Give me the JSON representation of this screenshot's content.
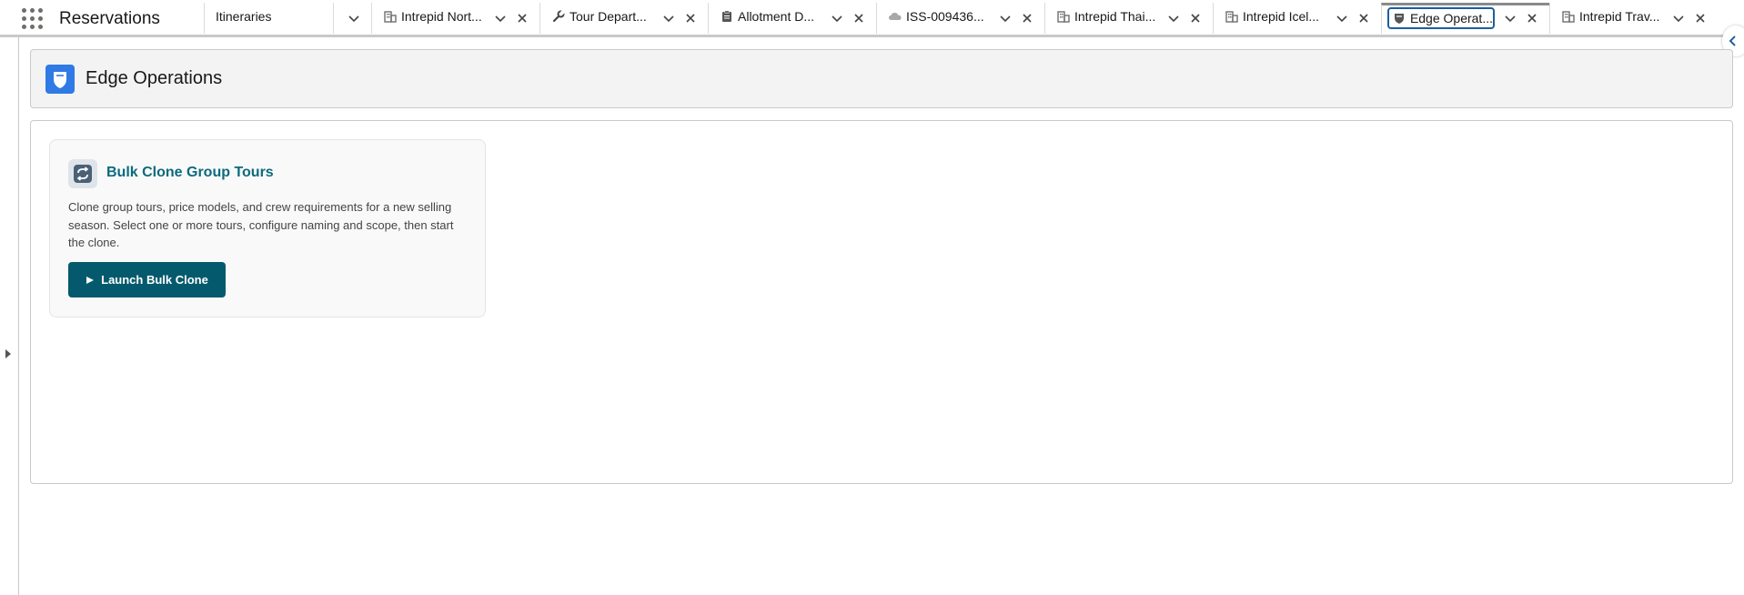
{
  "app": {
    "name": "Reservations",
    "launcher_icon": "app-launcher-grid-icon"
  },
  "tabs": [
    {
      "label": "Itineraries",
      "icon": null,
      "closable": false,
      "active": false
    },
    {
      "label": "Intrepid Nort...",
      "icon": "account-building-icon",
      "closable": true,
      "active": false
    },
    {
      "label": "Tour Depart...",
      "icon": "wrench-icon",
      "closable": true,
      "active": false
    },
    {
      "label": "Allotment D...",
      "icon": "clipboard-icon",
      "closable": true,
      "active": false
    },
    {
      "label": "ISS-009436...",
      "icon": "cloud-icon",
      "closable": true,
      "active": false
    },
    {
      "label": "Intrepid Thai...",
      "icon": "account-building-icon",
      "closable": true,
      "active": false
    },
    {
      "label": "Intrepid Icel...",
      "icon": "account-building-icon",
      "closable": true,
      "active": false
    },
    {
      "label": "Edge Operat...",
      "icon": "shield-icon",
      "closable": true,
      "active": true
    },
    {
      "label": "Intrepid Trav...",
      "icon": "account-building-icon",
      "closable": true,
      "active": false
    }
  ],
  "page_header": {
    "title": "Edge Operations",
    "icon": "shield-icon",
    "icon_color": "#2f7ae5"
  },
  "card": {
    "icon": "refresh-icon",
    "title": "Bulk Clone Group Tours",
    "description": "Clone group tours, price models, and crew requirements for a new selling season. Select one or more tours, configure naming and scope, then start the clone.",
    "button_label": "Launch Bulk Clone",
    "button_icon": "play-icon",
    "button_color": "#045a6c",
    "title_color": "#0b6b7c"
  },
  "colors": {
    "accent": "#1b5f9e"
  }
}
